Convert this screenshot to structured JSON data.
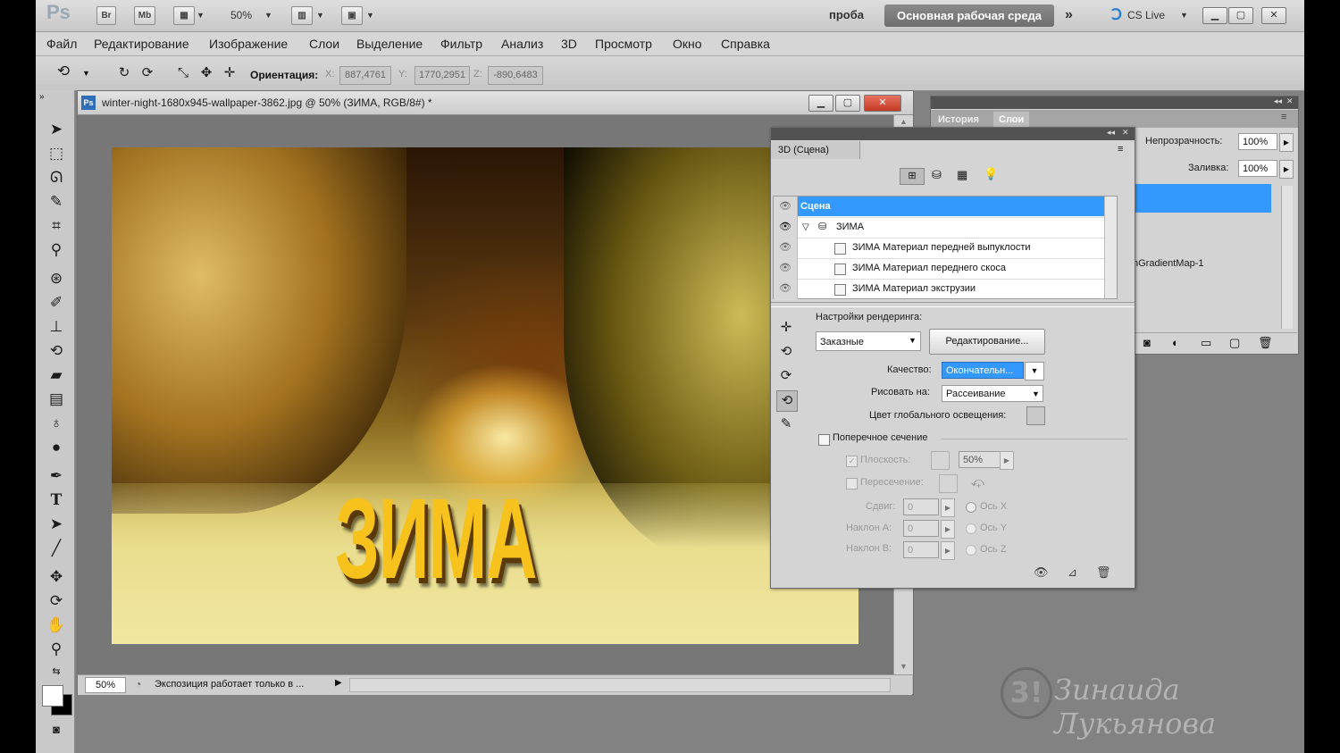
{
  "titlebar": {
    "ps_logo": "Ps",
    "br_label": "Br",
    "mb_label": "Mb",
    "zoom": "50%",
    "doc_name_btn": "проба",
    "workspace": "Основная рабочая среда",
    "cs_live": "CS Live"
  },
  "menu": [
    "Файл",
    "Редактирование",
    "Изображение",
    "Слои",
    "Выделение",
    "Фильтр",
    "Анализ",
    "3D",
    "Просмотр",
    "Окно",
    "Справка"
  ],
  "options": {
    "orientation_label": "Ориентация:",
    "x_label": "X:",
    "x_value": "887,4761",
    "y_label": "Y:",
    "y_value": "1770,2951",
    "z_label": "Z:",
    "z_value": "-890,6483"
  },
  "document": {
    "title": "winter-night-1680x945-wallpaper-3862.jpg @ 50% (ЗИМА, RGB/8#) *",
    "ps_badge": "Ps",
    "artwork_text": "ЗИМА",
    "status_zoom": "50%",
    "status_text": "Экспозиция работает только в ..."
  },
  "panel3d": {
    "tab": "3D (Сцена)",
    "scene_rows": [
      {
        "label": "Сцена",
        "selected": true
      },
      {
        "label": "ЗИМА",
        "selected": false
      },
      {
        "label": "ЗИМА Материал передней выпуклости",
        "selected": false
      },
      {
        "label": "ЗИМА Материал переднего скоса",
        "selected": false
      },
      {
        "label": "ЗИМА Материал экструзии",
        "selected": false
      }
    ],
    "render_settings_label": "Настройки рендеринга:",
    "preset": "Заказные",
    "edit_button": "Редактирование...",
    "quality_label": "Качество:",
    "quality_value": "Окончательн...",
    "draw_on_label": "Рисовать на:",
    "draw_on_value": "Рассеивание",
    "global_light_label": "Цвет глобального освещения:",
    "cross_section_label": "Поперечное сечение",
    "plane_label": "Плоскость:",
    "plane_value": "50%",
    "intersection_label": "Пересечение:",
    "offset_label": "Сдвиг:",
    "offset_value": "0",
    "tilt_a_label": "Наклон А:",
    "tilt_a_value": "0",
    "tilt_b_label": "Наклон В:",
    "tilt_b_value": "0",
    "axis_x": "Ось X",
    "axis_y": "Ось Y",
    "axis_z": "Ось Z"
  },
  "layers_panel": {
    "tab_history": "История",
    "tab_layers": "Слои",
    "opacity_label": "Непрозрачность:",
    "opacity_value": "100%",
    "fill_label": "Заливка:",
    "fill_value": "100%",
    "layer_partial": "nGradientMap-1"
  },
  "watermark": {
    "mark": "3!",
    "signature": "Зинаида Лукьянова"
  },
  "colors": {
    "selection_blue": "#3399ff",
    "zima_yellow": "#f6c21b",
    "close_red": "#d9412f"
  }
}
